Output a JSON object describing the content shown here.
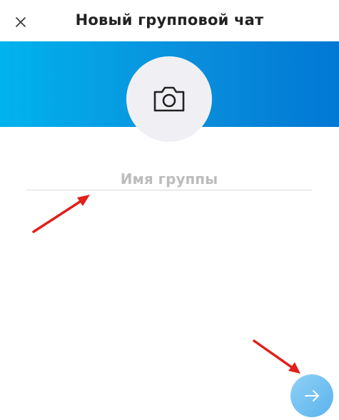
{
  "header": {
    "title": "Новый групповой чат",
    "close_icon": "close-icon"
  },
  "banner": {
    "gradient_colors": [
      "#00b3ee",
      "#0078d4"
    ]
  },
  "avatar": {
    "icon": "camera-icon",
    "background": "#f0f0f4"
  },
  "group_name": {
    "placeholder": "Имя группы",
    "value": ""
  },
  "next_button": {
    "icon": "arrow-right-icon",
    "color": "#5ab4ee"
  },
  "annotations": {
    "arrow_color": "#e0201b"
  }
}
